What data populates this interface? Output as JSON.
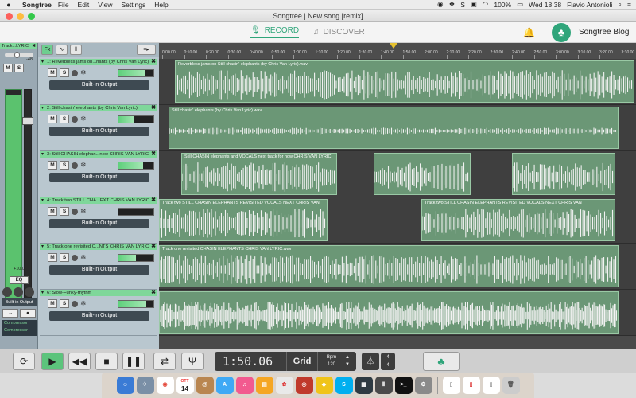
{
  "menubar": {
    "apple": "",
    "app": "Songtree",
    "items": [
      "File",
      "Edit",
      "View",
      "Settings",
      "Help"
    ],
    "battery": "100%",
    "clock": "Wed 18:38",
    "user": "Flavio Antonioli"
  },
  "window": {
    "title": "Songtree | New song [remix]"
  },
  "header": {
    "record": "RECORD",
    "discover": "DISCOVER",
    "blog": "Songtree Blog"
  },
  "master": {
    "name": "Track...LYRIC",
    "db_top": "-48",
    "db_bottom": "+10.0",
    "eq": "EQ",
    "output": "Built-in Output",
    "effects": [
      "Compressor",
      "Compressor"
    ]
  },
  "toolbar": {
    "fx": "Fx"
  },
  "tracks": [
    {
      "name": "1: Reverbless jams on...hants (by Chris Van Lyric)",
      "clip_label": "Reverbless jams on Still chasin' elephants (by Chris Van Lyric).wav",
      "output": "Built-in Output",
      "level": 0.75
    },
    {
      "name": "2: Still chasin' elephants (by Chris Van Lyric)",
      "clip_label": "Still chasin' elephants (by Chris Van Lyric).wav",
      "output": "Built-in Output",
      "level": 0.45
    },
    {
      "name": "3: Still CHASIN elephan...now CHRIS VAN LYRIC",
      "clip_label": "Still CHASIN elephants and VOCALS next track for now CHRIS VAN LYRIC",
      "output": "Built-in Output",
      "level": 0.7
    },
    {
      "name": "4: Track two STILL CHA...EXT CHRIS VAN LYRIC",
      "clip_label": "Track two STILL CHASIN ELEPHANTS REVISITED VOCALS NEXT CHRIS VAN",
      "clip_label_2": "Track two STILL CHASIN ELEPHANTS REVISITED VOCALS NEXT CHRIS VAN",
      "output": "Built-in Output",
      "level": 0.0
    },
    {
      "name": "5: Track one revisited C...NTS CHRIS VAN LYRIC",
      "clip_label": "Track one revisited CHASIN ELEPHANTS CHRIS VAN LYRIC.wav",
      "output": "Built-in Output",
      "level": 0.5
    },
    {
      "name": "6: Slow-Funky-rhythm",
      "clip_label": "",
      "output": "Built-in Output",
      "level": 0.8
    }
  ],
  "ruler": {
    "ticks": [
      "0:00.00",
      "0:10.00",
      "0:20.00",
      "0:30.00",
      "0:40.00",
      "0:50.00",
      "1:00.00",
      "1:10.00",
      "1:20.00",
      "1:30.00",
      "1:40.00",
      "1:50.00",
      "2:00.00",
      "2:10.00",
      "2:20.00",
      "2:30.00",
      "2:40.00",
      "2:50.00",
      "3:00.00",
      "3:10.00",
      "3:20.00",
      "3:30.00"
    ]
  },
  "transport": {
    "time": "1:50.06",
    "grid": "Grid",
    "bpm_label": "Bpm",
    "bpm": "120",
    "sig_top": "4",
    "sig_bottom": "4"
  },
  "dock": {
    "calendar_day": "14",
    "calendar_month": "OTT"
  }
}
